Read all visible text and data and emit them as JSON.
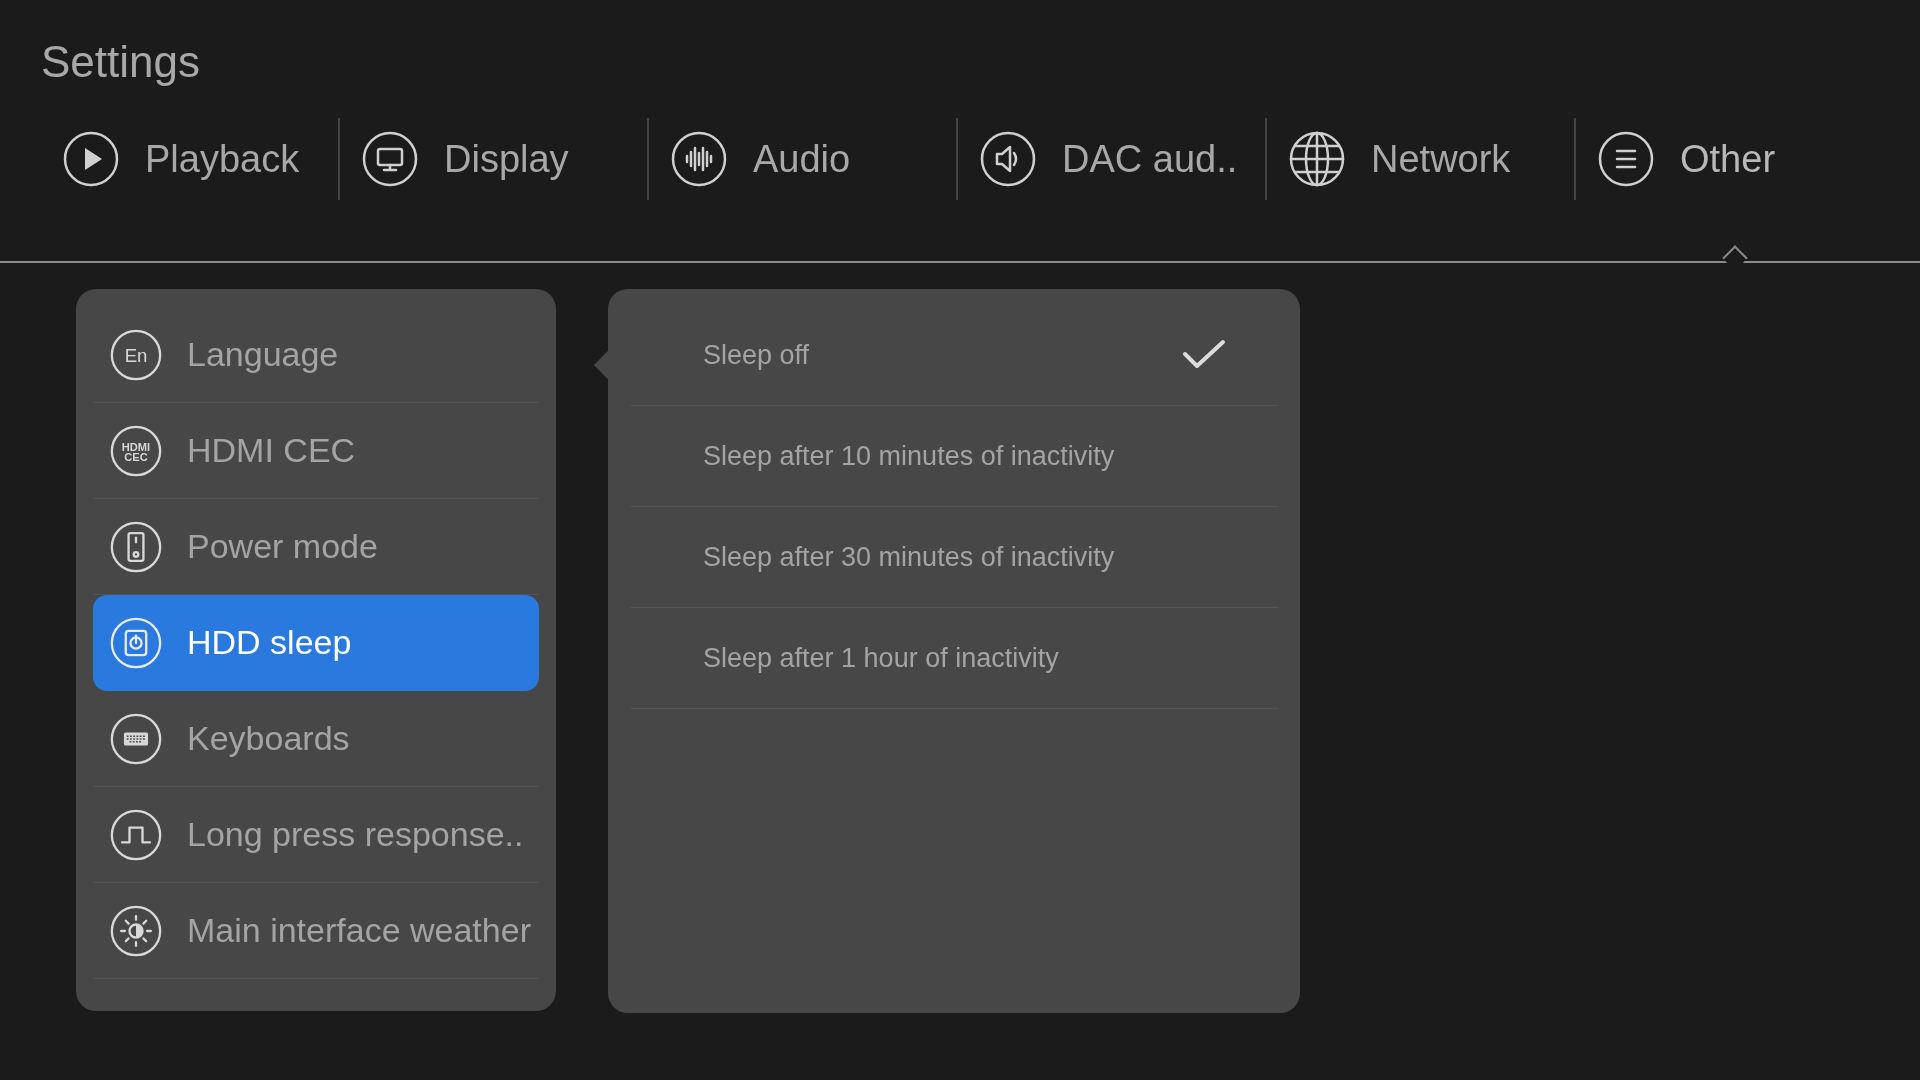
{
  "window": {
    "title": "Settings"
  },
  "tabs": [
    {
      "label": "Playback",
      "kind": "play",
      "selected": false
    },
    {
      "label": "Display",
      "kind": "monitor",
      "selected": false
    },
    {
      "label": "Audio",
      "kind": "wave",
      "selected": false
    },
    {
      "label": "DAC aud..",
      "kind": "speaker",
      "selected": false
    },
    {
      "label": "Network",
      "kind": "globe",
      "selected": false
    },
    {
      "label": "Other",
      "kind": "list",
      "selected": true
    }
  ],
  "sidebar": {
    "items": [
      {
        "label": "Language",
        "kind": "text",
        "icon_text": [
          "En"
        ],
        "selected": false
      },
      {
        "label": "HDMI CEC",
        "kind": "text",
        "icon_text": [
          "HDMI",
          "CEC"
        ],
        "selected": false
      },
      {
        "label": "Power mode",
        "kind": "power",
        "selected": false
      },
      {
        "label": "HDD sleep",
        "kind": "hdd",
        "selected": true
      },
      {
        "label": "Keyboards",
        "kind": "keyboard",
        "selected": false
      },
      {
        "label": "Long press response..",
        "kind": "pulse",
        "selected": false
      },
      {
        "label": "Main interface weather",
        "kind": "sun",
        "selected": false
      }
    ]
  },
  "options": [
    {
      "label": "Sleep off",
      "selected": true
    },
    {
      "label": "Sleep after 10 minutes of inactivity",
      "selected": false
    },
    {
      "label": "Sleep after 30 minutes of inactivity",
      "selected": false
    },
    {
      "label": "Sleep after 1 hour of inactivity",
      "selected": false
    }
  ]
}
